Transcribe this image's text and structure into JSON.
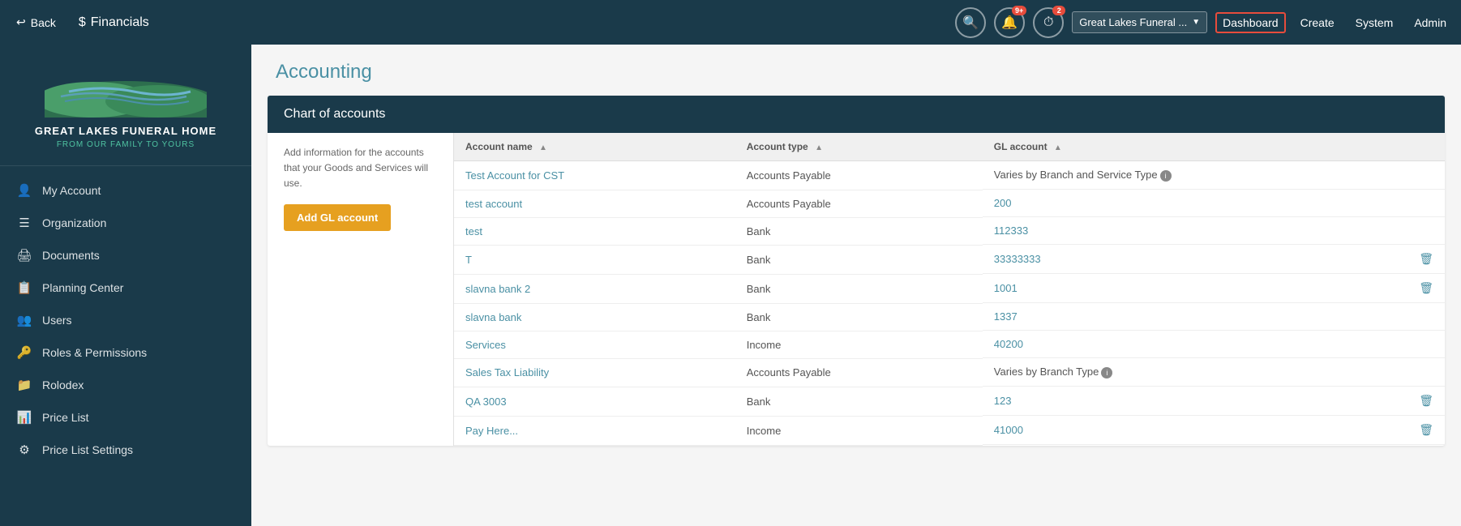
{
  "topNav": {
    "backLabel": "Back",
    "financialsLabel": "Financials",
    "notifications": {
      "searchTitle": "Search",
      "bellTitle": "Notifications",
      "bellBadge": "9+",
      "clockTitle": "Clock",
      "clockBadge": "2"
    },
    "orgDropdown": "Great Lakes Funeral ...",
    "links": [
      {
        "label": "Dashboard",
        "active": true
      },
      {
        "label": "Create",
        "active": false
      },
      {
        "label": "System",
        "active": false
      },
      {
        "label": "Admin",
        "active": false
      }
    ]
  },
  "sidebar": {
    "logoName": "Great Lakes Funeral Home",
    "logoTagline": "From Our Family To Yours",
    "items": [
      {
        "label": "My Account",
        "icon": "👤",
        "id": "my-account"
      },
      {
        "label": "Organization",
        "icon": "☰",
        "id": "organization"
      },
      {
        "label": "Documents",
        "icon": "🖨",
        "id": "documents"
      },
      {
        "label": "Planning Center",
        "icon": "📋",
        "id": "planning-center"
      },
      {
        "label": "Users",
        "icon": "👥",
        "id": "users"
      },
      {
        "label": "Roles & Permissions",
        "icon": "🔑",
        "id": "roles-permissions"
      },
      {
        "label": "Rolodex",
        "icon": "📁",
        "id": "rolodex"
      },
      {
        "label": "Price List",
        "icon": "📊",
        "id": "price-list"
      },
      {
        "label": "Price List Settings",
        "icon": "⚙",
        "id": "price-list-settings"
      }
    ]
  },
  "content": {
    "pageTitle": "Accounting",
    "chartOfAccounts": {
      "header": "Chart of accounts",
      "description": "Add information for the accounts that your Goods and Services will use.",
      "addButtonLabel": "Add GL account",
      "columns": [
        {
          "label": "Account name",
          "id": "account-name"
        },
        {
          "label": "Account type",
          "id": "account-type"
        },
        {
          "label": "GL account",
          "id": "gl-account"
        }
      ],
      "rows": [
        {
          "accountName": "Test Account for CST",
          "accountType": "Accounts Payable",
          "glAccount": "Varies by Branch and Service Type",
          "variesInfo": true,
          "hasDelete": false
        },
        {
          "accountName": "test account",
          "accountType": "Accounts Payable",
          "glAccount": "200",
          "variesInfo": false,
          "hasDelete": false
        },
        {
          "accountName": "test",
          "accountType": "Bank",
          "glAccount": "112333",
          "variesInfo": false,
          "hasDelete": false
        },
        {
          "accountName": "T",
          "accountType": "Bank",
          "glAccount": "33333333",
          "variesInfo": false,
          "hasDelete": true
        },
        {
          "accountName": "slavna bank 2",
          "accountType": "Bank",
          "glAccount": "1001",
          "variesInfo": false,
          "hasDelete": true
        },
        {
          "accountName": "slavna bank",
          "accountType": "Bank",
          "glAccount": "1337",
          "variesInfo": false,
          "hasDelete": false
        },
        {
          "accountName": "Services",
          "accountType": "Income",
          "glAccount": "40200",
          "variesInfo": false,
          "hasDelete": false
        },
        {
          "accountName": "Sales Tax Liability",
          "accountType": "Accounts Payable",
          "glAccount": "Varies by Branch Type",
          "variesInfo": true,
          "hasDelete": false
        },
        {
          "accountName": "QA 3003",
          "accountType": "Bank",
          "glAccount": "123",
          "variesInfo": false,
          "hasDelete": true
        },
        {
          "accountName": "Pay Here...",
          "accountType": "Income",
          "glAccount": "41000",
          "variesInfo": false,
          "hasDelete": true
        }
      ]
    }
  }
}
